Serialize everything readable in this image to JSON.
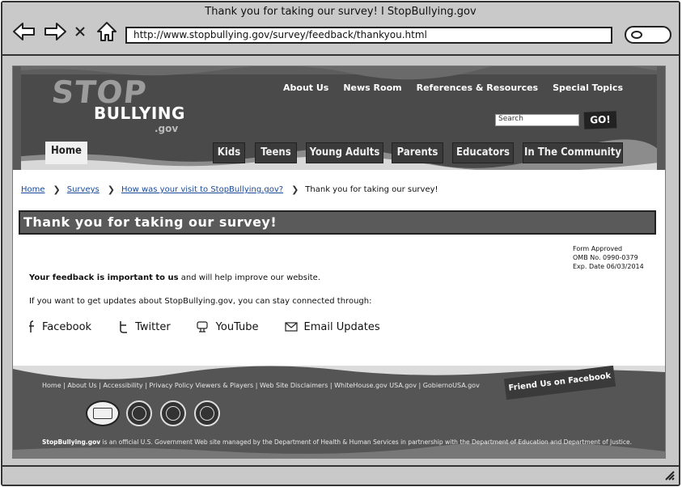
{
  "window": {
    "title": "Thank you for taking our survey! I StopBullying.gov",
    "url": "http://www.stopbullying.gov/survey/feedback/thankyou.html"
  },
  "header": {
    "logo": {
      "line1": "STOP",
      "line2": "BULLYING",
      "line3": ".gov"
    },
    "top_links": [
      "About Us",
      "News Room",
      "References & Resources",
      "Special Topics"
    ],
    "search": {
      "value": "Search"
    },
    "go_label": "GO!",
    "tabs": [
      "Home",
      "Kids",
      "Teens",
      "Young Adults",
      "Parents",
      "Educators",
      "In The Community"
    ]
  },
  "breadcrumb": {
    "items": [
      "Home",
      "Surveys",
      "How was your visit to StopBullying.gov?"
    ],
    "current": "Thank you for taking our survey!"
  },
  "main": {
    "heading": "Thank you for taking our survey!",
    "form_approved": [
      "Form Approved",
      "OMB No. 0990-0379",
      "Exp. Date 06/03/2014"
    ],
    "feedback_bold": "Your feedback is important to us",
    "feedback_rest": " and will help improve our website.",
    "updates_text": "If you want to get updates about StopBullying.gov, you can stay connected through:",
    "social": [
      {
        "label": "Facebook",
        "icon": "facebook-icon"
      },
      {
        "label": "Twitter",
        "icon": "twitter-icon"
      },
      {
        "label": "YouTube",
        "icon": "youtube-icon"
      },
      {
        "label": "Email Updates",
        "icon": "email-icon"
      }
    ]
  },
  "footer": {
    "links": "Home | About Us | Accessibility | Privacy Policy   Viewers & Players | Web Site Disclaimers | WhiteHouse.gov   USA.gov | GobiernoUSA.gov",
    "facebook_badge": "Friend Us on Facebook",
    "disclaimer_brand": "StopBullying.gov",
    "disclaimer_rest": " is an official U.S. Government Web site managed by the Department of Health & Human Services in partnership with the Department of Education and Department of Justice."
  }
}
